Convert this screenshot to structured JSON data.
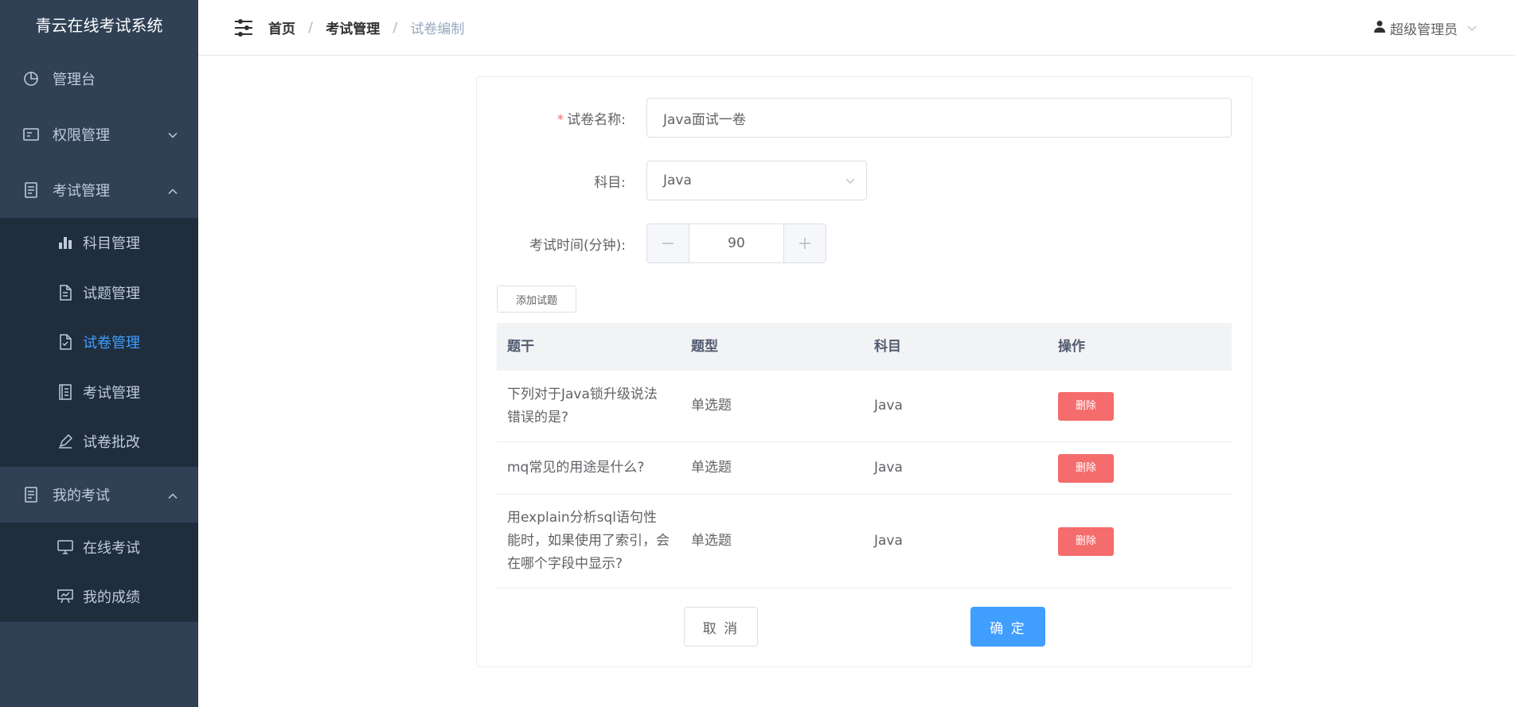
{
  "app": {
    "title": "青云在线考试系统"
  },
  "sidebar": {
    "items": [
      {
        "label": "管理台",
        "icon": "pie-chart-icon"
      },
      {
        "label": "权限管理",
        "icon": "id-card-icon"
      },
      {
        "label": "考试管理",
        "icon": "document-icon"
      },
      {
        "label": "我的考试",
        "icon": "document-icon"
      }
    ],
    "exam_sub": [
      {
        "label": "科目管理",
        "icon": "bar-chart-icon"
      },
      {
        "label": "试题管理",
        "icon": "file-text-icon"
      },
      {
        "label": "试卷管理",
        "icon": "file-check-icon"
      },
      {
        "label": "考试管理",
        "icon": "notebook-icon"
      },
      {
        "label": "试卷批改",
        "icon": "pen-icon"
      }
    ],
    "myexam_sub": [
      {
        "label": "在线考试",
        "icon": "monitor-icon"
      },
      {
        "label": "我的成绩",
        "icon": "presentation-icon"
      }
    ]
  },
  "header": {
    "breadcrumb": [
      "首页",
      "考试管理",
      "试卷编制"
    ],
    "separator": "/",
    "user": "超级管理员"
  },
  "form": {
    "name_label": "试卷名称:",
    "required_mark": "*",
    "name_value": "Java面试一卷",
    "subject_label": "科目:",
    "subject_value": "Java",
    "time_label": "考试时间(分钟):",
    "time_value": "90",
    "minus": "−",
    "plus": "+"
  },
  "add_button": "添加试题",
  "table": {
    "headers": [
      "题干",
      "题型",
      "科目",
      "操作"
    ],
    "rows": [
      {
        "stem": "下列对于Java锁升级说法错误的是?",
        "type": "单选题",
        "subject": "Java",
        "action": "删除"
      },
      {
        "stem": "mq常见的用途是什么?",
        "type": "单选题",
        "subject": "Java",
        "action": "删除"
      },
      {
        "stem": "用explain分析sql语句性能时，如果使用了索引，会在哪个字段中显示?",
        "type": "单选题",
        "subject": "Java",
        "action": "删除"
      }
    ]
  },
  "buttons": {
    "cancel": "取 消",
    "confirm": "确 定"
  },
  "colors": {
    "sidebar_bg": "#304156",
    "submenu_bg": "#1f2d3d",
    "accent": "#409eff",
    "danger": "#f56c6c"
  }
}
